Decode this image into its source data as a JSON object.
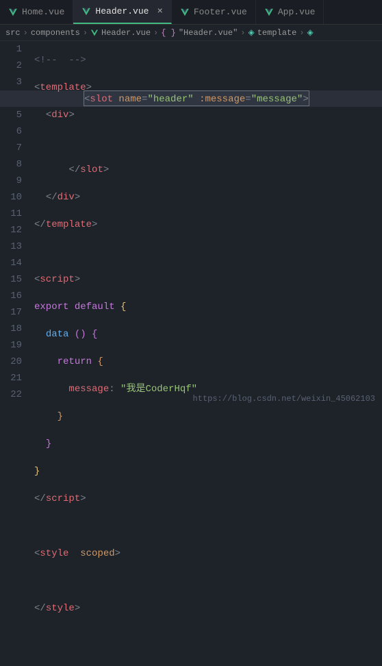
{
  "tabs": [
    {
      "label": "Home.vue",
      "active": false
    },
    {
      "label": "Header.vue",
      "active": true
    },
    {
      "label": "Footer.vue",
      "active": false
    },
    {
      "label": "App.vue",
      "active": false
    }
  ],
  "breadcrumb": {
    "src": "src",
    "components": "components",
    "file": "Header.vue",
    "section": "\"Header.vue\"",
    "template": "template"
  },
  "code": {
    "line1": {
      "open": "<!--",
      "close": "-->"
    },
    "line2": {
      "open": "<",
      "tag": "template",
      "close": ">"
    },
    "line3": {
      "open": "<",
      "tag": "div",
      "close": ">"
    },
    "line4": {
      "open": "<",
      "tag": "slot",
      "attr1": "name",
      "eq": "=",
      "val1": "\"header\"",
      "attr2": ":message",
      "val2": "\"message\"",
      "close": ">"
    },
    "line5": {
      "open": "</",
      "tag": "slot",
      "close": ">"
    },
    "line6": {
      "open": "</",
      "tag": "div",
      "close": ">"
    },
    "line7": {
      "open": "</",
      "tag": "template",
      "close": ">"
    },
    "line9": {
      "open": "<",
      "tag": "script",
      "close": ">"
    },
    "line10": {
      "kw1": "export",
      "kw2": "default",
      "brace": " {"
    },
    "line11": {
      "fn": "data",
      "paren": " () {"
    },
    "line12": {
      "kw": "return",
      "brace": " {"
    },
    "line13": {
      "prop": "message",
      "colon": ": ",
      "val": "\"我是CoderHqf\""
    },
    "line14": {
      "brace": "}"
    },
    "line15": {
      "brace": "}"
    },
    "line16": {
      "brace": "}"
    },
    "line17": {
      "open": "</",
      "tag": "script",
      "close": ">"
    },
    "line19": {
      "open": "<",
      "tag": "style",
      "attr": "scoped",
      "close": ">"
    },
    "line21": {
      "open": "</",
      "tag": "style",
      "close": ">"
    }
  },
  "watermark": "https://blog.csdn.net/weixin_45062103"
}
